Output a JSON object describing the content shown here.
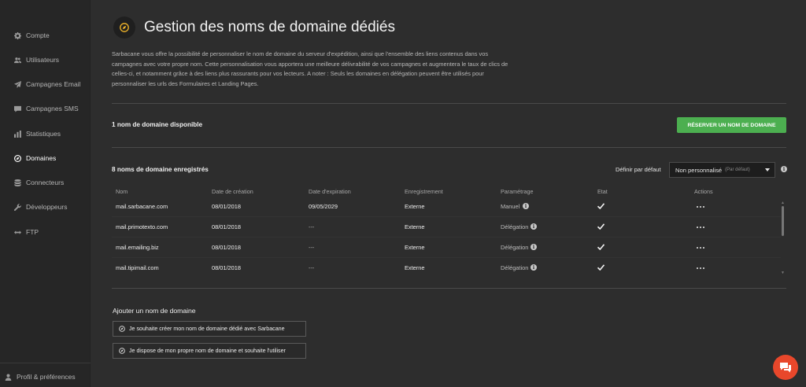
{
  "sidebar": {
    "items": [
      {
        "label": "Compte",
        "icon": "gear-icon"
      },
      {
        "label": "Utilisateurs",
        "icon": "users-icon"
      },
      {
        "label": "Campagnes Email",
        "icon": "paper-plane-icon"
      },
      {
        "label": "Campagnes SMS",
        "icon": "chat-bubble-icon"
      },
      {
        "label": "Statistiques",
        "icon": "bar-chart-icon"
      },
      {
        "label": "Domaines",
        "icon": "compass-icon"
      },
      {
        "label": "Connecteurs",
        "icon": "database-icon"
      },
      {
        "label": "Développeurs",
        "icon": "wrench-icon"
      },
      {
        "label": "FTP",
        "icon": "arrows-icon"
      }
    ],
    "active": "Domaines",
    "profile_label": "Profil & préférences"
  },
  "header": {
    "title": "Gestion des noms de domaine dédiés",
    "intro": "Sarbacane vous offre la possibilité de personnaliser le nom de domaine du serveur d'expédition, ainsi que l'ensemble des liens contenus dans vos campagnes avec votre propre nom. Cette personnalisation vous apportera une meilleure délivrabilité de vos campagnes et augmentera le taux de clics de celles-ci, et notamment grâce à des liens plus rassurants pour vos lecteurs. A noter : Seuls les domaines en délégation peuvent être utilisés pour personnaliser les urls des Formulaires et Landing Pages."
  },
  "available": {
    "text": "1 nom de domaine disponible",
    "reserve_button": "RÉSERVER UN NOM DE DOMAINE"
  },
  "registered": {
    "text": "8 noms de domaine enregistrés",
    "default_label": "Définir par défaut",
    "default_value": "Non personnalisé",
    "default_hint": "(Par défaut)"
  },
  "table": {
    "columns": [
      "Nom",
      "Date de création",
      "Date d'expiration",
      "Enregistrement",
      "Paramétrage",
      "Etat",
      "Actions"
    ],
    "rows": [
      {
        "name": "mail.sarbacane.com",
        "created": "08/01/2018",
        "expires": "09/05/2029",
        "registration": "Externe",
        "setting": "Manuel",
        "state": "check"
      },
      {
        "name": "mail.primotexto.com",
        "created": "08/01/2018",
        "expires": "---",
        "registration": "Externe",
        "setting": "Délégation",
        "state": "check"
      },
      {
        "name": "mail.emailing.biz",
        "created": "08/01/2018",
        "expires": "---",
        "registration": "Externe",
        "setting": "Délégation",
        "state": "check"
      },
      {
        "name": "mail.tipimail.com",
        "created": "08/01/2018",
        "expires": "---",
        "registration": "Externe",
        "setting": "Délégation",
        "state": "check"
      }
    ]
  },
  "add": {
    "title": "Ajouter un nom de domaine",
    "option1": "Je souhaite créer mon nom de domaine dédié avec Sarbacane",
    "option2": "Je dispose de mon propre nom de domaine et souhaite l'utiliser"
  },
  "colors": {
    "accent_green": "#4caf50",
    "chat_orange": "#e8472b",
    "title_icon_yellow": "#f0b429",
    "background": "#2d2d2d"
  }
}
